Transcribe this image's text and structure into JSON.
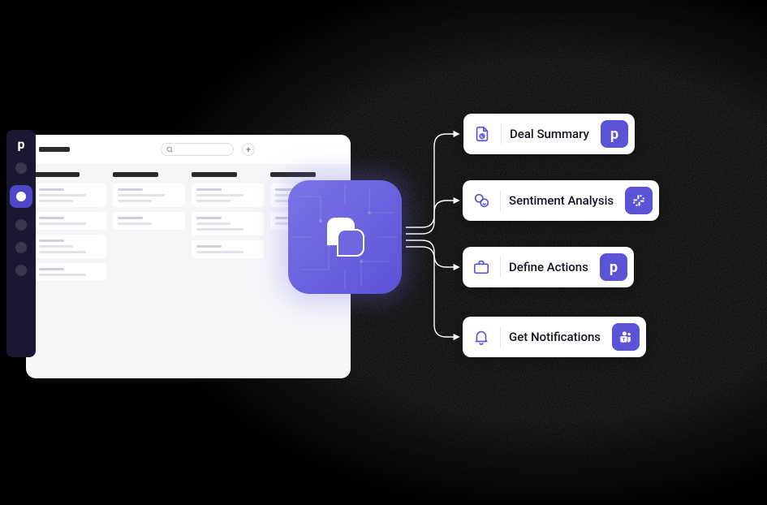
{
  "rail": {
    "logo_letter": "p",
    "dots": [
      {
        "active": false
      },
      {
        "active": true
      },
      {
        "active": false
      },
      {
        "active": false
      },
      {
        "active": false
      }
    ]
  },
  "app": {
    "search_placeholder": "",
    "add_label": "+",
    "columns": [
      {
        "cards": 4
      },
      {
        "cards": 2
      },
      {
        "cards": 3
      },
      {
        "cards": 2
      }
    ]
  },
  "hub": {
    "name": "ai-hub"
  },
  "actions": [
    {
      "id": "deal-summary",
      "label": "Deal Summary",
      "icon": "report-icon",
      "badge": "pipedrive"
    },
    {
      "id": "sentiment-analysis",
      "label": "Sentiment Analysis",
      "icon": "sentiment-icon",
      "badge": "slack"
    },
    {
      "id": "define-actions",
      "label": "Define Actions",
      "icon": "briefcase-icon",
      "badge": "pipedrive"
    },
    {
      "id": "get-notifications",
      "label": "Get Notifications",
      "icon": "bell-icon",
      "badge": "teams"
    }
  ]
}
